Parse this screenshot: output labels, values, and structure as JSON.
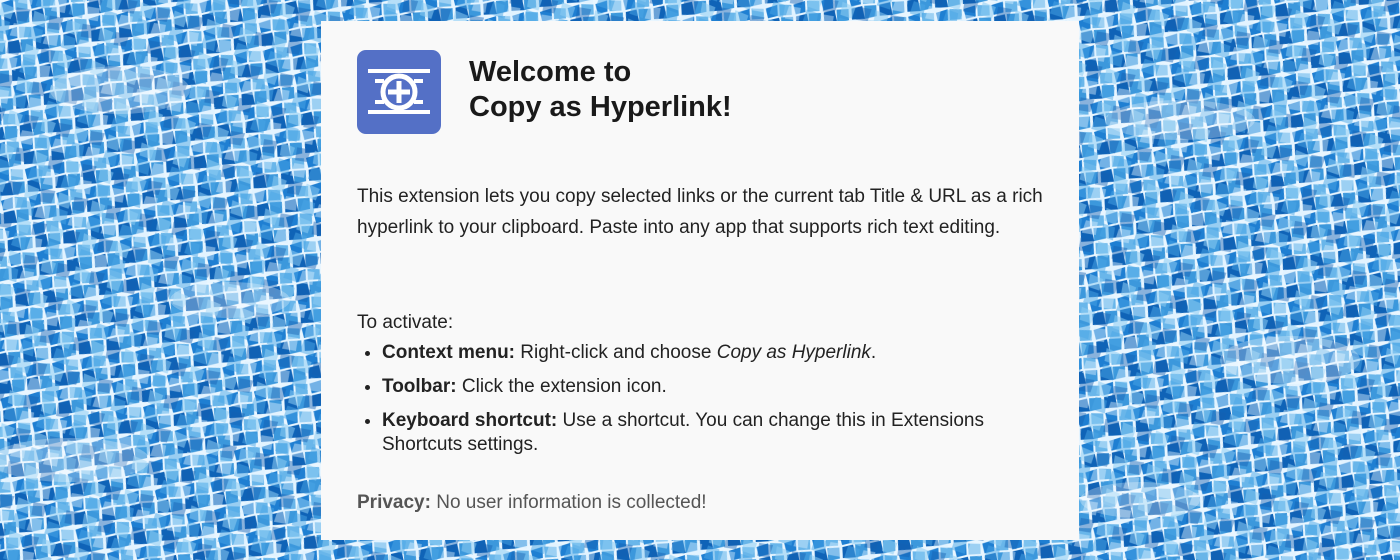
{
  "colors": {
    "card_background": "#f9f9f9",
    "logo_background": "#5470c6",
    "logo_foreground": "#ffffff",
    "water_light": "#7fc1ef",
    "water_mid": "#2c8bd6",
    "water_dark": "#0d5fb4"
  },
  "header": {
    "logo_icon": "copy-hyperlink-icon",
    "title_line1": "Welcome to",
    "title_line2": "Copy as Hyperlink!"
  },
  "description": "This extension lets you copy selected links or the current tab Title & URL as a rich hyperlink to your clipboard. Paste into any app that supports rich text editing.",
  "activation": {
    "heading": "To activate:",
    "methods": [
      {
        "label": "Context menu:",
        "text_before": " Right-click and choose ",
        "emphasis": "Copy as Hyperlink",
        "text_after": "."
      },
      {
        "label": "Toolbar:",
        "text": " Click the extension icon."
      },
      {
        "label": "Keyboard shortcut:",
        "text": " Use a shortcut. You can change this in Extensions Shortcuts settings."
      }
    ]
  },
  "privacy": {
    "label": "Privacy:",
    "text": " No user information is collected!"
  }
}
